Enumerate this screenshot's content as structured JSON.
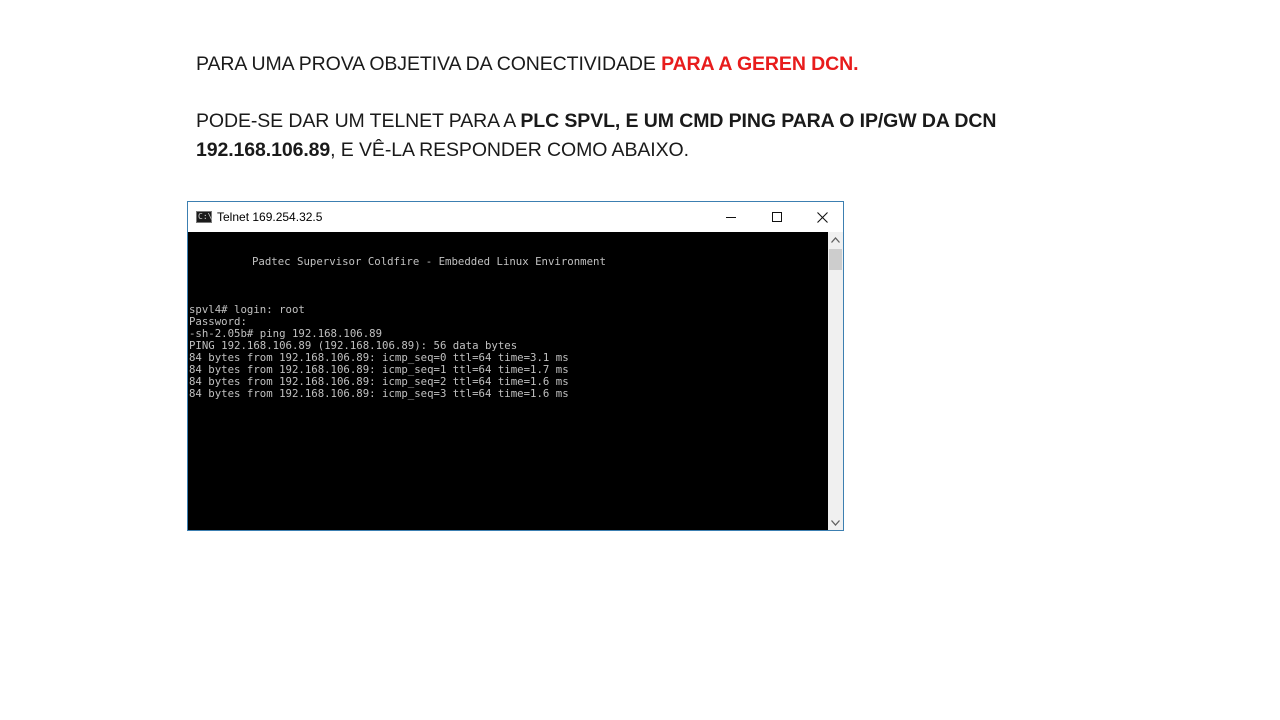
{
  "slide": {
    "line1_prefix": "PARA UMA PROVA OBJETIVA DA CONECTIVIDADE ",
    "line1_highlight": "PARA A GEREN DCN.",
    "line2_prefix": "PODE-SE DAR UM TELNET PARA A ",
    "line2_bold": "PLC SPVL, E UM CMD PING PARA O IP/GW DA DCN",
    "line3_bold": "192.168.106.89",
    "line3_suffix": ",  E VÊ-LA RESPONDER COMO ABAIXO.",
    "highlight_color": "#e81c1c"
  },
  "window": {
    "title": "Telnet 169.254.32.5",
    "icon": "console-icon",
    "icon_text": "C:\\",
    "controls": [
      "minimize-icon",
      "maximize-icon",
      "close-icon"
    ]
  },
  "console": {
    "banner": "Padtec Supervisor Coldfire - Embedded Linux Environment",
    "lines": [
      "spvl4# login: root",
      "Password:",
      "-sh-2.05b# ping 192.168.106.89",
      "PING 192.168.106.89 (192.168.106.89): 56 data bytes",
      "84 bytes from 192.168.106.89: icmp_seq=0 ttl=64 time=3.1 ms",
      "84 bytes from 192.168.106.89: icmp_seq=1 ttl=64 time=1.7 ms",
      "84 bytes from 192.168.106.89: icmp_seq=2 ttl=64 time=1.6 ms",
      "84 bytes from 192.168.106.89: icmp_seq=3 ttl=64 time=1.6 ms"
    ],
    "background": "#000000",
    "text_color": "#c0c0c0"
  }
}
